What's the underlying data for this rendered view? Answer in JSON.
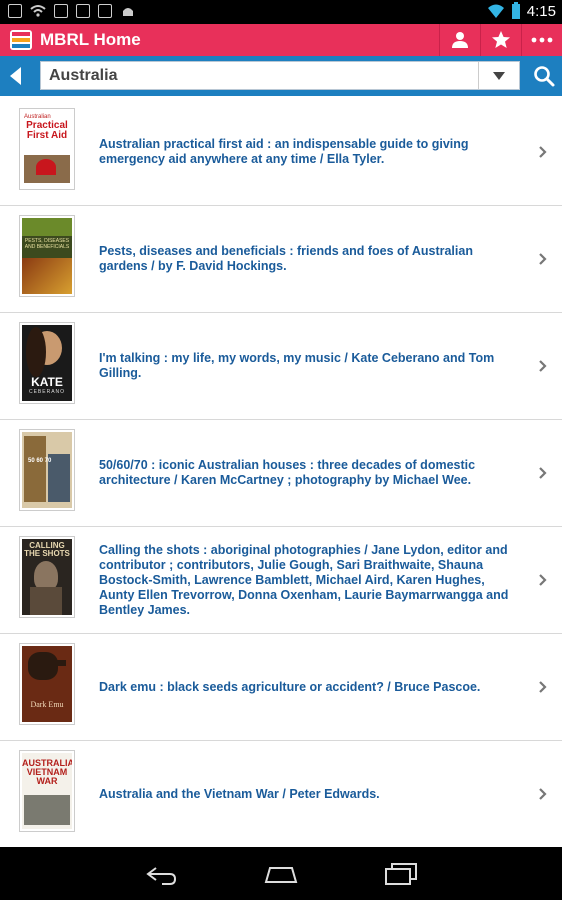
{
  "status_bar": {
    "time": "4:15"
  },
  "action_bar": {
    "title": "MBRL Home"
  },
  "search": {
    "value": "Australia"
  },
  "results": [
    {
      "title": "Australian practical first aid : an indispensable guide to giving emergency aid anywhere at any time / Ella Tyler.",
      "cover_text": "Practical First Aid",
      "cover_top": "Australian"
    },
    {
      "title": "Pests, diseases and beneficials : friends and foes of Australian gardens / by F. David Hockings.",
      "cover_text": "PESTS, DISEASES AND BENEFICIALS"
    },
    {
      "title": "I'm talking : my life, my words, my music / Kate Ceberano and Tom Gilling.",
      "cover_text": "KATE",
      "cover_sub": "CEBERANO"
    },
    {
      "title": "50/60/70 : iconic Australian houses : three decades of domestic architecture / Karen McCartney ; photography by Michael Wee.",
      "cover_text": "50 60 70"
    },
    {
      "title": "Calling the shots : aboriginal photographies / Jane Lydon, editor and contributor ; contributors, Julie Gough, Sari Braithwaite, Shauna Bostock-Smith, Lawrence Bamblett, Michael Aird, Karen Hughes, Aunty Ellen Trevorrow, Donna Oxenham, Laurie Baymarrwangga and Bentley James.",
      "cover_text": "CALLING THE SHOTS"
    },
    {
      "title": "Dark emu : black seeds agriculture or accident? / Bruce Pascoe.",
      "cover_text": "Dark Emu"
    },
    {
      "title": "Australia and the Vietnam War / Peter Edwards.",
      "cover_text": "AUSTRALIA VIETNAM WAR"
    }
  ]
}
